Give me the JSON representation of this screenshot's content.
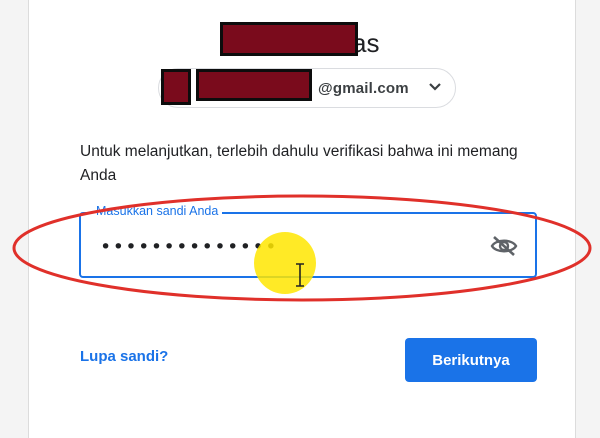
{
  "heading": {
    "visible_suffix": "as"
  },
  "account": {
    "email_suffix": "@gmail.com",
    "chevron_icon": "chevron-down-icon"
  },
  "instruction": "Untuk melanjutkan, terlebih dahulu verifikasi bahwa ini memang Anda",
  "password": {
    "label": "Masukkan sandi Anda",
    "masked_value": "••••••••••••••",
    "visibility_icon": "eye-off-icon"
  },
  "actions": {
    "forgot_label": "Lupa sandi?",
    "next_label": "Berikutnya"
  },
  "colors": {
    "accent": "#1a73e8",
    "annotation": "#e0302a",
    "highlight": "#ffe600",
    "redaction": "#7a0b1c"
  }
}
